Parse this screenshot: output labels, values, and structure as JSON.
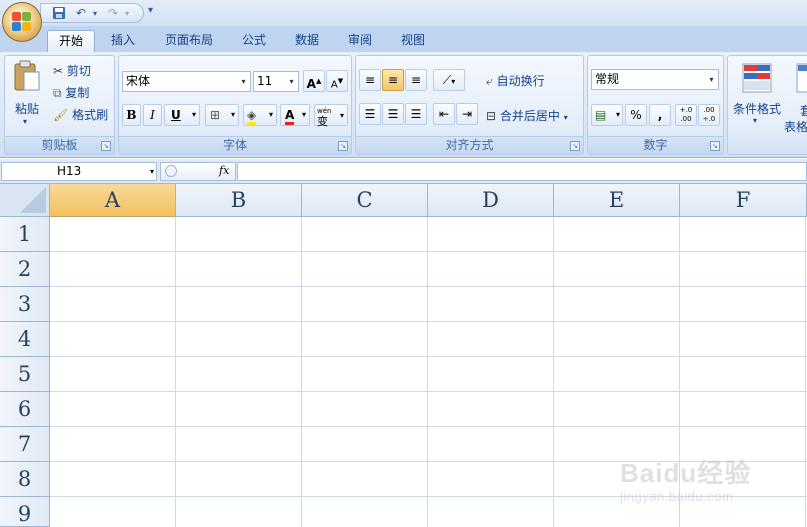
{
  "quick_access": {
    "undo": "↶",
    "redo": "↷",
    "customize": "▾"
  },
  "tabs": [
    {
      "label": "开始",
      "active": true
    },
    {
      "label": "插入"
    },
    {
      "label": "页面布局"
    },
    {
      "label": "公式"
    },
    {
      "label": "数据"
    },
    {
      "label": "审阅"
    },
    {
      "label": "视图"
    }
  ],
  "clipboard": {
    "paste": "粘贴",
    "cut": "剪切",
    "copy": "复制",
    "format_painter": "格式刷",
    "group": "剪贴板"
  },
  "font": {
    "name": "宋体",
    "size": "11",
    "bold": "B",
    "italic": "I",
    "underline": "U",
    "grow": "A",
    "shrink": "A",
    "color_letter": "A",
    "phonetic": "wén",
    "phonetic_char": "变",
    "group": "字体"
  },
  "alignment": {
    "wrap": "自动换行",
    "merge": "合并后居中",
    "group": "对齐方式"
  },
  "number": {
    "format": "常规",
    "percent": "%",
    "comma": ",",
    "inc_decimal": "+.0 .00",
    "dec_decimal": ".00 ÷.0",
    "group": "数字"
  },
  "styles": {
    "conditional": "条件格式",
    "table_format_1": "套",
    "table_format_2": "表格"
  },
  "formula_bar": {
    "name_box": "H13",
    "fx": "fx",
    "value": ""
  },
  "sheet": {
    "columns": [
      "A",
      "B",
      "C",
      "D",
      "E",
      "F"
    ],
    "rows": [
      "1",
      "2",
      "3",
      "4",
      "5",
      "6",
      "7",
      "8",
      "9"
    ],
    "selected_column": "A"
  },
  "watermark": {
    "main": "Baidu经验",
    "sub": "jingyan.baidu.com"
  },
  "colors": {
    "ribbon_bg": "#dce8f7",
    "selected_header": "#f1c15d",
    "gridline": "#d0d7e5"
  }
}
